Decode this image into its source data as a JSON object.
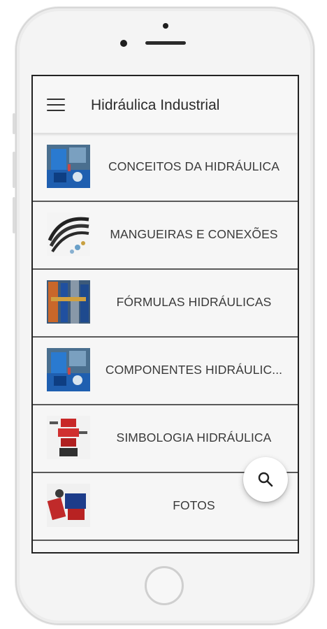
{
  "app": {
    "title": "Hidráulica Industrial"
  },
  "menu": {
    "icon": "hamburger-menu-icon"
  },
  "items": [
    {
      "label": "CONCEITOS DA HIDRÁULICA",
      "thumb": "hydraulic-unit-photo"
    },
    {
      "label": "MANGUEIRAS E CONEXÕES",
      "thumb": "hoses-photo"
    },
    {
      "label": "FÓRMULAS HIDRÁULICAS",
      "thumb": "hydraulic-cylinders-photo"
    },
    {
      "label": "COMPONENTES HIDRÁULIC...",
      "thumb": "hydraulic-unit-photo"
    },
    {
      "label": "SIMBOLOGIA HIDRÁULICA",
      "thumb": "valve-stack-photo"
    },
    {
      "label": "FOTOS",
      "thumb": "hydraulic-parts-photo"
    }
  ],
  "fab": {
    "icon": "search-icon"
  },
  "colors": {
    "background": "#f5f5f5",
    "divider": "#5a5a5a",
    "text": "#3a3a3a"
  }
}
